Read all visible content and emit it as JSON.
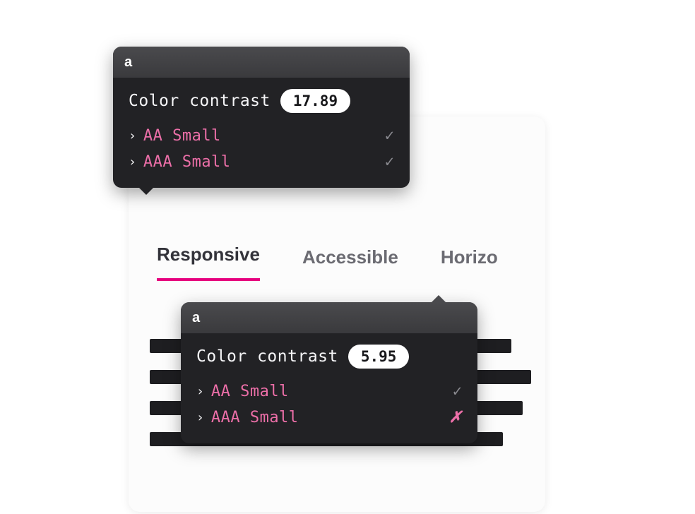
{
  "tabs": {
    "responsive": "Responsive",
    "accessible": "Accessible",
    "horizontal": "Horizo"
  },
  "tooltip1": {
    "headerLabel": "a",
    "title": "Color contrast",
    "ratio": "17.89",
    "rows": [
      {
        "label": "AA Small",
        "pass": true
      },
      {
        "label": "AAA Small",
        "pass": true
      }
    ]
  },
  "tooltip2": {
    "headerLabel": "a",
    "title": "Color contrast",
    "ratio": "5.95",
    "rows": [
      {
        "label": "AA Small",
        "pass": true
      },
      {
        "label": "AAA Small",
        "pass": false
      }
    ]
  },
  "colors": {
    "accent": "#e6007e",
    "labelPink": "#ec6fa8",
    "tooltipBg": "#222225"
  }
}
